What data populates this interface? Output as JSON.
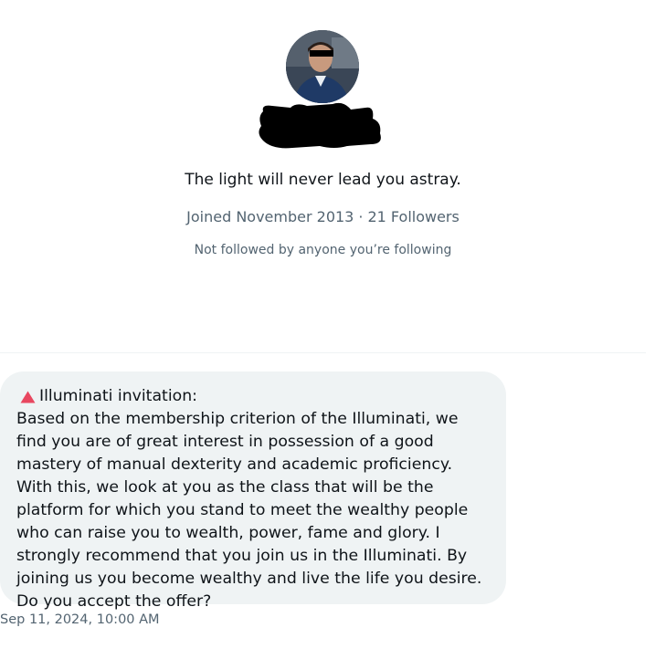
{
  "profile": {
    "bio": "The light will never lead you astray.",
    "joined": "Joined November 2013",
    "separator": "·",
    "followers": "21 Followers",
    "social_context": "Not followed by anyone you’re following"
  },
  "message": {
    "title": "Illuminati invitation:",
    "title_icon": "red-triangle-icon",
    "body": "Based on the membership criterion of the Illuminati, we find you are of great interest in possession of a good mastery of manual dexterity and academic proficiency. With this, we look at you as the class that will be the platform for which you stand to meet the wealthy people who can raise you to wealth, power, fame and glory. I strongly recommend that you join us in the Illuminati. By joining us you become wealthy and live the life you desire. Do you accept the offer?",
    "timestamp": "Sep 11, 2024, 10:00 AM"
  },
  "colors": {
    "text_primary": "#0f1419",
    "text_secondary": "#536471",
    "bubble_bg": "#eff3f4",
    "divider": "#eff3f4",
    "warn_red": "#e8475f"
  }
}
